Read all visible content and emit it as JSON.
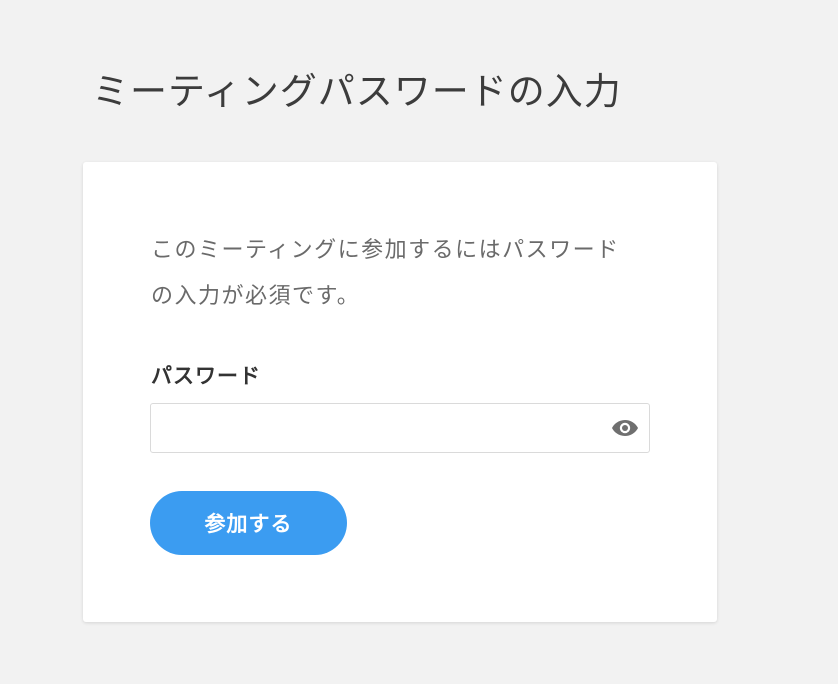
{
  "page": {
    "title": "ミーティングパスワードの入力"
  },
  "card": {
    "description": "このミーティングに参加するにはパスワードの入力が必須です。",
    "password_label": "パスワード",
    "password_value": "",
    "password_placeholder": "",
    "show_password_icon": "eye-icon",
    "join_button_label": "参加する"
  },
  "colors": {
    "background": "#f2f2f2",
    "card": "#ffffff",
    "button": "#3b9cf1",
    "icon": "#6f6f6f"
  }
}
